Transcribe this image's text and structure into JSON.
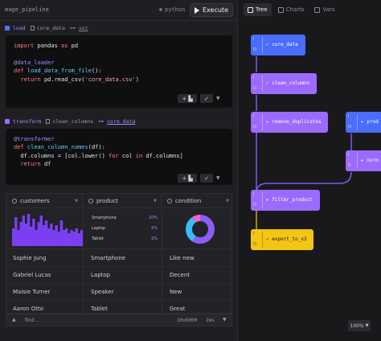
{
  "topbar": {
    "pipeline_name": "mage_pipeline",
    "language": "python",
    "execute_label": "Execute"
  },
  "blocks": [
    {
      "type": "load",
      "name": "core_data",
      "link": "set",
      "color": "#5b6cff",
      "code": [
        [
          {
            "c": "kw",
            "t": "import"
          },
          {
            "c": "tx",
            "t": " pandas "
          },
          {
            "c": "kw",
            "t": "as"
          },
          {
            "c": "tx",
            "t": " pd"
          }
        ],
        [],
        [
          {
            "c": "dec",
            "t": "@data_loader"
          }
        ],
        [
          {
            "c": "kw",
            "t": "def"
          },
          {
            "c": "fn",
            "t": " load_data_from_file"
          },
          {
            "c": "tx",
            "t": "():"
          }
        ],
        [
          {
            "c": "tx",
            "t": "  "
          },
          {
            "c": "kw",
            "t": "return"
          },
          {
            "c": "tx",
            "t": " pd.read_csv("
          },
          {
            "c": "str",
            "t": "'core_data.csv'"
          },
          {
            "c": "tx",
            "t": ")"
          }
        ]
      ]
    },
    {
      "type": "transform",
      "name": "clean_columns",
      "link": "core_data",
      "color": "#9d6bff",
      "code": [
        [
          {
            "c": "dec",
            "t": "@transformer"
          }
        ],
        [
          {
            "c": "kw",
            "t": "def"
          },
          {
            "c": "fn",
            "t": " clean_column_names"
          },
          {
            "c": "tx",
            "t": "(df):"
          }
        ],
        [
          {
            "c": "tx",
            "t": "  df.columns = [col.lower() "
          },
          {
            "c": "kw",
            "t": "for"
          },
          {
            "c": "tx",
            "t": " col "
          },
          {
            "c": "kw",
            "t": "in"
          },
          {
            "c": "tx",
            "t": " df.columns]"
          }
        ],
        [
          {
            "c": "tx",
            "t": "  "
          },
          {
            "c": "kw",
            "t": "return"
          },
          {
            "c": "tx",
            "t": " df"
          }
        ]
      ]
    }
  ],
  "table": {
    "columns": [
      "customers",
      "product",
      "condition"
    ],
    "histogram": [
      0.55,
      0.9,
      0.5,
      0.75,
      0.95,
      0.7,
      1.0,
      0.6,
      0.85,
      0.5,
      0.75,
      0.95,
      0.65,
      0.8,
      0.55,
      0.7,
      0.5,
      0.65,
      0.45,
      0.8,
      0.5,
      0.55,
      0.4,
      0.5,
      0.45,
      0.55,
      0.4,
      0.5
    ],
    "product_stats": [
      {
        "label": "Smartphone",
        "value": "10%"
      },
      {
        "label": "Laptop",
        "value": "5%"
      },
      {
        "label": "Tablet",
        "value": "2%"
      }
    ],
    "rows": [
      [
        "Sophie Jung",
        "Smartphone",
        "Like new"
      ],
      [
        "Gabriel Lucas",
        "Laptop",
        "Decent"
      ],
      [
        "Maisie Turner",
        "Speaker",
        "New"
      ],
      [
        "Aaron Otto",
        "Tablet",
        "Great"
      ]
    ],
    "footer": {
      "find_label": "find...",
      "dimensions": "10x6000",
      "timing": "2ms"
    }
  },
  "right": {
    "tabs": [
      {
        "label": "Tree",
        "active": true
      },
      {
        "label": "Charts",
        "active": false
      },
      {
        "label": "Vars",
        "active": false
      }
    ],
    "nodes": [
      {
        "label": "core_data",
        "color": "#4a6cff",
        "icon": "✓"
      },
      {
        "label": "clean_columns",
        "color": "#9b6bff",
        "icon": "✓"
      },
      {
        "label": "remove_duplicates",
        "color": "#9b6bff",
        "icon": "▸"
      },
      {
        "label": "prod",
        "color": "#4a6cff",
        "icon": "▸"
      },
      {
        "label": "norm",
        "color": "#9b6bff",
        "icon": "▸"
      },
      {
        "label": "filter_product",
        "color": "#9b6bff",
        "icon": "▸"
      },
      {
        "label": "export_to_s3",
        "color": "#f3c515",
        "icon": "✓"
      }
    ],
    "io_label_in": "I",
    "io_label_out": "O",
    "zoom": "100%"
  },
  "colors": {
    "accent": "#8f6bff",
    "histogram": "#7b3ff2",
    "donut_a": "#8b5cf6",
    "donut_b": "#38bdf8",
    "donut_c": "#ff5fd2"
  }
}
